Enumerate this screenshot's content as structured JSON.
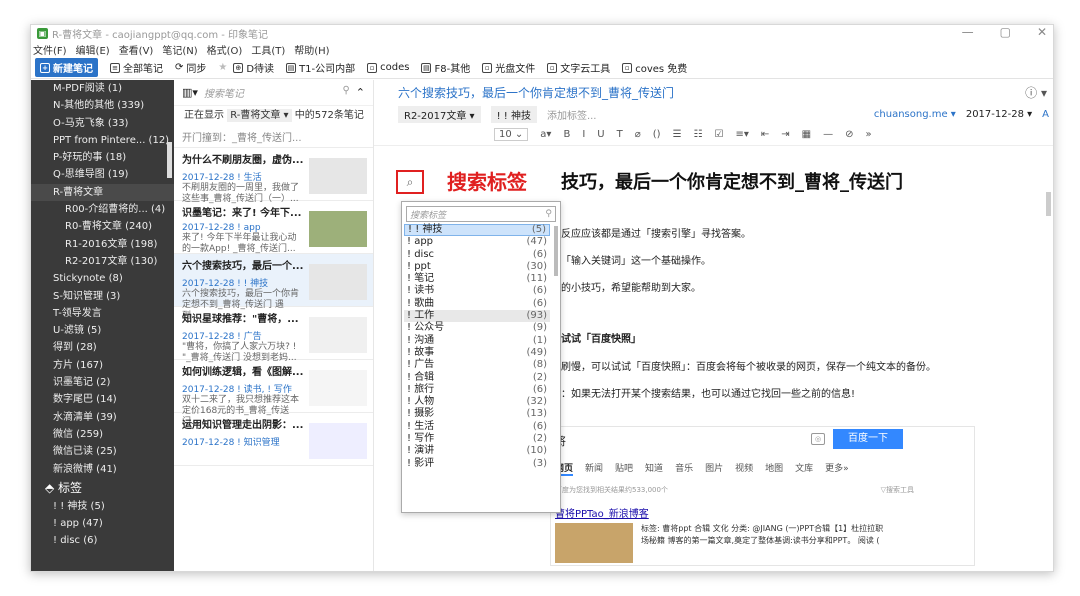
{
  "window": {
    "title": "R-曹将文章 - caojiangppt@qq.com - 印象笔记",
    "controls": [
      "—",
      "▢",
      "✕"
    ]
  },
  "menu": [
    "文件(F)",
    "编辑(E)",
    "查看(V)",
    "笔记(N)",
    "格式(O)",
    "工具(T)",
    "帮助(H)"
  ],
  "toolbar": {
    "new_note": "新建笔记",
    "all_notes": "全部笔记",
    "sync": "同步",
    "shortcuts": [
      "D待读",
      "T1-公司内部",
      "codes",
      "F8-其他",
      "光盘文件",
      "文字云工具",
      "coves 免费"
    ]
  },
  "sidebar": {
    "items": [
      {
        "label": "M-PDF阅读 (1)",
        "indent": 0
      },
      {
        "label": "N-其他的其他 (339)",
        "indent": 0
      },
      {
        "label": "O-马克飞象 (33)",
        "indent": 0
      },
      {
        "label": "PPT from Pintere... (12)",
        "indent": 0
      },
      {
        "label": "P-好玩的事 (18)",
        "indent": 0
      },
      {
        "label": "Q-思维导图 (19)",
        "indent": 0
      },
      {
        "label": "R-曹将文章",
        "indent": 0
      },
      {
        "label": "R00-介绍曹将的... (4)",
        "indent": 1
      },
      {
        "label": "R0-曹将文章 (240)",
        "indent": 1
      },
      {
        "label": "R1-2016文章 (198)",
        "indent": 1
      },
      {
        "label": "R2-2017文章 (130)",
        "indent": 1
      },
      {
        "label": "Stickynote (8)",
        "indent": 0
      },
      {
        "label": "S-知识管理 (3)",
        "indent": 0
      },
      {
        "label": "T-领导发言",
        "indent": 0
      },
      {
        "label": "U-滤镜 (5)",
        "indent": 0
      },
      {
        "label": "得到 (28)",
        "indent": 0
      },
      {
        "label": "方片 (167)",
        "indent": 0
      },
      {
        "label": "识墨笔记 (2)",
        "indent": 0
      },
      {
        "label": "数字尾巴 (14)",
        "indent": 0
      },
      {
        "label": "水滴清单 (39)",
        "indent": 0
      },
      {
        "label": "微信 (259)",
        "indent": 0
      },
      {
        "label": "微信已读 (25)",
        "indent": 0
      },
      {
        "label": "新浪微博 (41)",
        "indent": 0
      }
    ],
    "tags_section": "标签",
    "tags": [
      "! ! 神技 (5)",
      "! app (47)",
      "! disc (6)"
    ]
  },
  "notelist": {
    "search_placeholder": "搜索笔记",
    "showing_prefix": "正在显示",
    "showing_notebook": "R-曹将文章 ▾",
    "showing_suffix": "中的572条笔记",
    "notes": [
      {
        "title": "开门撞到：_曹将_传送门...",
        "meta": "",
        "snippet": ""
      },
      {
        "title": "为什么不刷朋友圈，虚伪...",
        "meta": "2017-12-28 ! 生活",
        "snippet": "不刷朋友圈的一周里，我做了这些事_曹将_传送门（一）..."
      },
      {
        "title": "识墨笔记：来了! 今年下...",
        "meta": "2017-12-28 ! app",
        "snippet": "来了! 今年下半年最让我心动的一款App! _曹将_传送门..."
      },
      {
        "title": "六个搜索技巧，最后一个...",
        "meta": "2017-12-28 ! ! 神技",
        "snippet": "六个搜索技巧，最后一个你肯定想不到_曹将_传送门 遇到..."
      },
      {
        "title": "知识星球推荐：\"曹将，...",
        "meta": "2017-12-28 ! 广告",
        "snippet": "\"曹将，你搞了人家六万块? ! \"_曹将_传送门 没想到老妈..."
      },
      {
        "title": "如何训练逻辑，看《图解...",
        "meta": "2017-12-28 ! 读书, ! 写作",
        "snippet": "双十二来了，我只想推荐这本定价168元的书_曹将_传送门..."
      },
      {
        "title": "运用知识管理走出阴影：...",
        "meta": "2017-12-28 ! 知识管理",
        "snippet": ""
      }
    ]
  },
  "editor": {
    "title": "六个搜索技巧，最后一个你肯定想不到_曹将_传送门",
    "notebook": "R2-2017文章 ▾",
    "tag": "! ! 神技",
    "add_tag": "添加标签...",
    "source": "chuansong.me ▾",
    "date": "2017-12-28 ▾",
    "font_size": "10",
    "heading": "技巧，最后一个你肯定想不到_曹将_传送门",
    "lines": [
      "反应应该都是通过「搜索引擎」寻找答案。",
      "「输入关键词」这一个基础操作。",
      "的小技巧，希望能帮助到大家。",
      "试试「百度快照」",
      "刷慢，可以试试「百度快照」：百度会将每个被收录的网页，保存一个纯文本的备份。",
      "：如果无法打开某个搜索结果，也可以通过它找回一些之前的信息!"
    ],
    "baidu": {
      "query": "将",
      "button": "百度一下",
      "tabs": [
        "网页",
        "新闻",
        "贴吧",
        "知道",
        "音乐",
        "图片",
        "视频",
        "地图",
        "文库",
        "更多»"
      ],
      "count": "百度为您找到相关结果约533,000个",
      "tools": "▽搜索工具",
      "result_title": "曹将PPTao_新浪博客",
      "result_line1": "标签: 曹将ppt 合辑 文化 分类: @JIANG (一)PPT合辑【1】杜拉拉职",
      "result_line2": "场秘籍 博客的第一篇文章,奠定了整体基调:读书分享和PPT。 阅读 ("
    }
  },
  "tag_popup": {
    "search_placeholder": "搜索标签",
    "items": [
      {
        "name": "! ! 神技",
        "count": "(5)"
      },
      {
        "name": "! app",
        "count": "(47)"
      },
      {
        "name": "! disc",
        "count": "(6)"
      },
      {
        "name": "! ppt",
        "count": "(30)"
      },
      {
        "name": "! 笔记",
        "count": "(11)"
      },
      {
        "name": "! 读书",
        "count": "(6)"
      },
      {
        "name": "! 歌曲",
        "count": "(6)"
      },
      {
        "name": "! 工作",
        "count": "(93)"
      },
      {
        "name": "! 公众号",
        "count": "(9)"
      },
      {
        "name": "! 沟通",
        "count": "(1)"
      },
      {
        "name": "! 故事",
        "count": "(49)"
      },
      {
        "name": "! 广告",
        "count": "(8)"
      },
      {
        "name": "! 合辑",
        "count": "(2)"
      },
      {
        "name": "! 旅行",
        "count": "(6)"
      },
      {
        "name": "! 人物",
        "count": "(32)"
      },
      {
        "name": "! 摄影",
        "count": "(13)"
      },
      {
        "name": "! 生活",
        "count": "(6)"
      },
      {
        "name": "! 写作",
        "count": "(2)"
      },
      {
        "name": "! 演讲",
        "count": "(10)"
      },
      {
        "name": "! 影评",
        "count": "(3)"
      }
    ]
  },
  "annotation": {
    "label": "搜索标签"
  },
  "colors": {
    "accent": "#2b73c8",
    "sidebar_bg": "#3a3a3a",
    "callout_red": "#e02020"
  }
}
